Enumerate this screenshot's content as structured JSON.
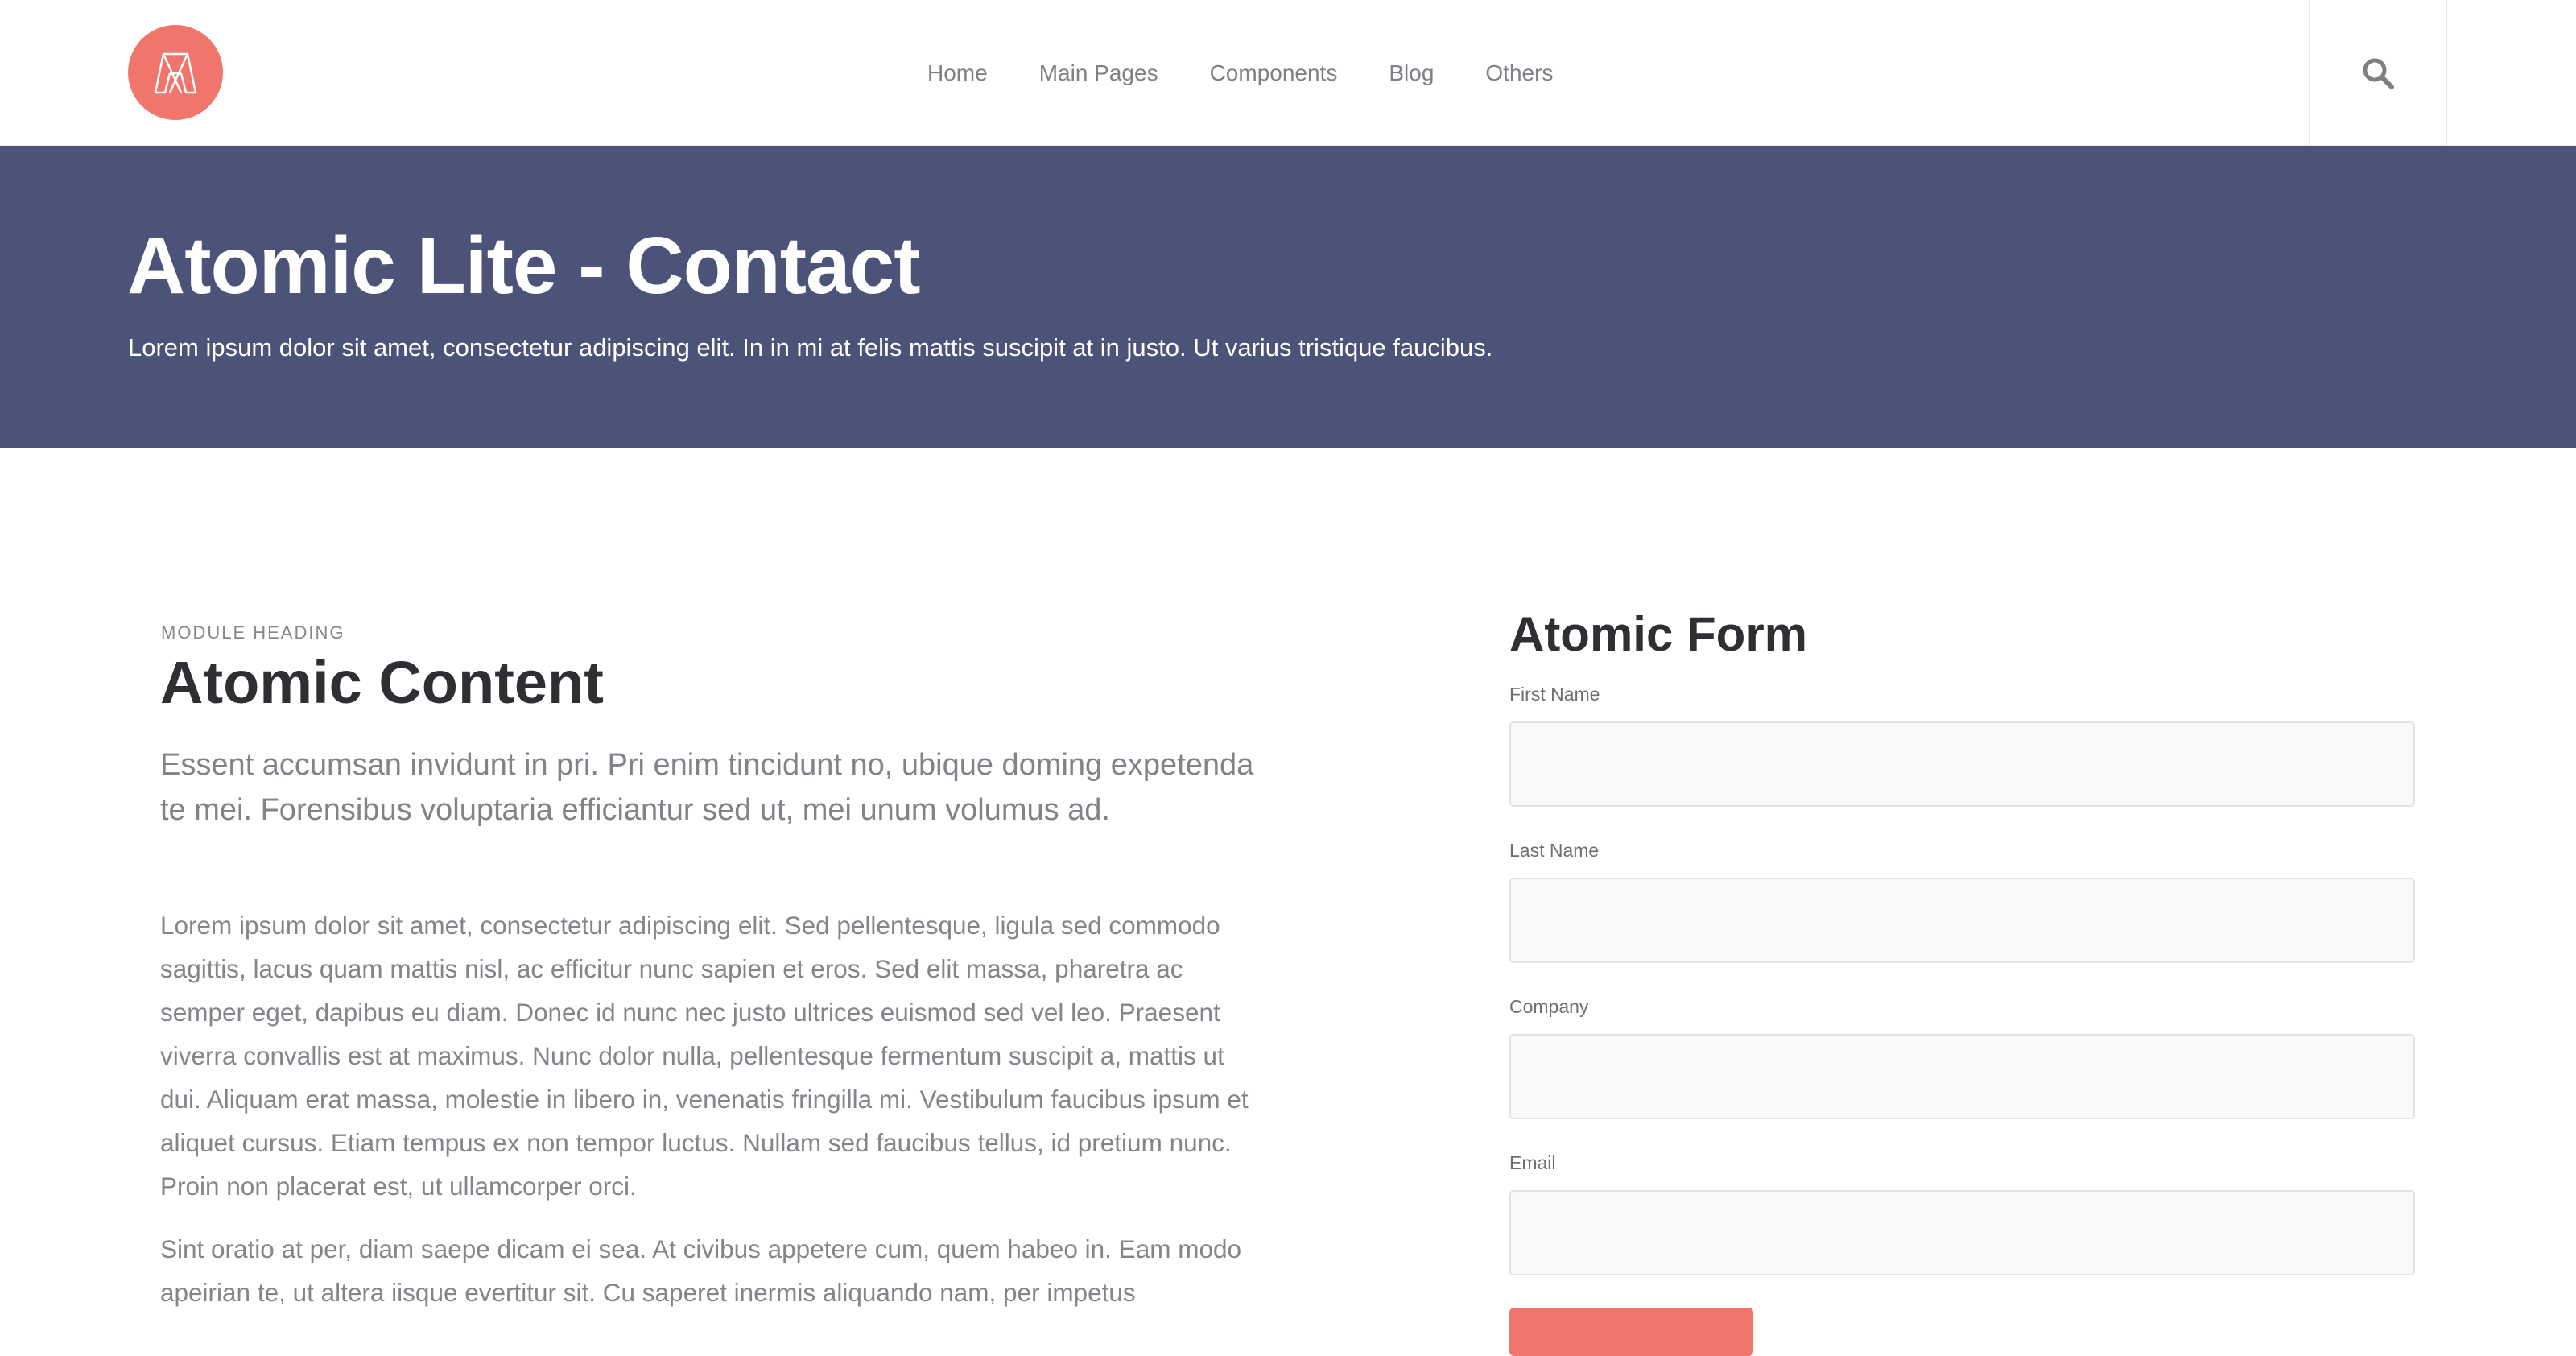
{
  "header": {
    "nav": [
      "Home",
      "Main Pages",
      "Components",
      "Blog",
      "Others"
    ],
    "logo_icon": "atomic-logo-icon",
    "search_icon": "search-icon"
  },
  "hero": {
    "title": "Atomic Lite - Contact",
    "subtitle": "Lorem ipsum dolor sit amet, consectetur adipiscing elit. In in mi at felis mattis suscipit at in justo. Ut varius tristique faucibus."
  },
  "content": {
    "module_heading": "MODULE HEADING",
    "title": "Atomic Content",
    "lead": "Essent accumsan invidunt in pri. Pri enim tincidunt no, ubique doming expetenda te mei. Forensibus voluptaria efficiantur sed ut, mei unum volumus ad.",
    "paragraph1": "Lorem ipsum dolor sit amet, consectetur adipiscing elit. Sed pellentesque, ligula sed commodo sagittis, lacus quam mattis nisl, ac efficitur nunc sapien et eros. Sed elit massa, pharetra ac semper eget, dapibus eu diam. Donec id nunc nec justo ultrices euismod sed vel leo. Praesent viverra convallis est at maximus. Nunc dolor nulla, pellentesque fermentum suscipit a, mattis ut dui. Aliquam erat massa, molestie in libero in, venenatis fringilla mi. Vestibulum faucibus ipsum et aliquet cursus. Etiam tempus ex non tempor luctus. Nullam sed faucibus tellus, id pretium nunc. Proin non placerat est, ut ullamcorper orci.",
    "paragraph2": "Sint oratio at per, diam saepe dicam ei sea. At civibus appetere cum, quem habeo in. Eam modo apeirian te, ut altera iisque evertitur sit. Cu saperet inermis aliquando nam, per impetus"
  },
  "form": {
    "title": "Atomic Form",
    "fields": [
      {
        "label": "First Name",
        "value": ""
      },
      {
        "label": "Last Name",
        "value": ""
      },
      {
        "label": "Company",
        "value": ""
      },
      {
        "label": "Email",
        "value": ""
      }
    ]
  },
  "colors": {
    "accent": "#f0756b",
    "hero_bg": "#4b5478",
    "text_dark": "#2f2f33",
    "text_muted": "#84848a"
  }
}
